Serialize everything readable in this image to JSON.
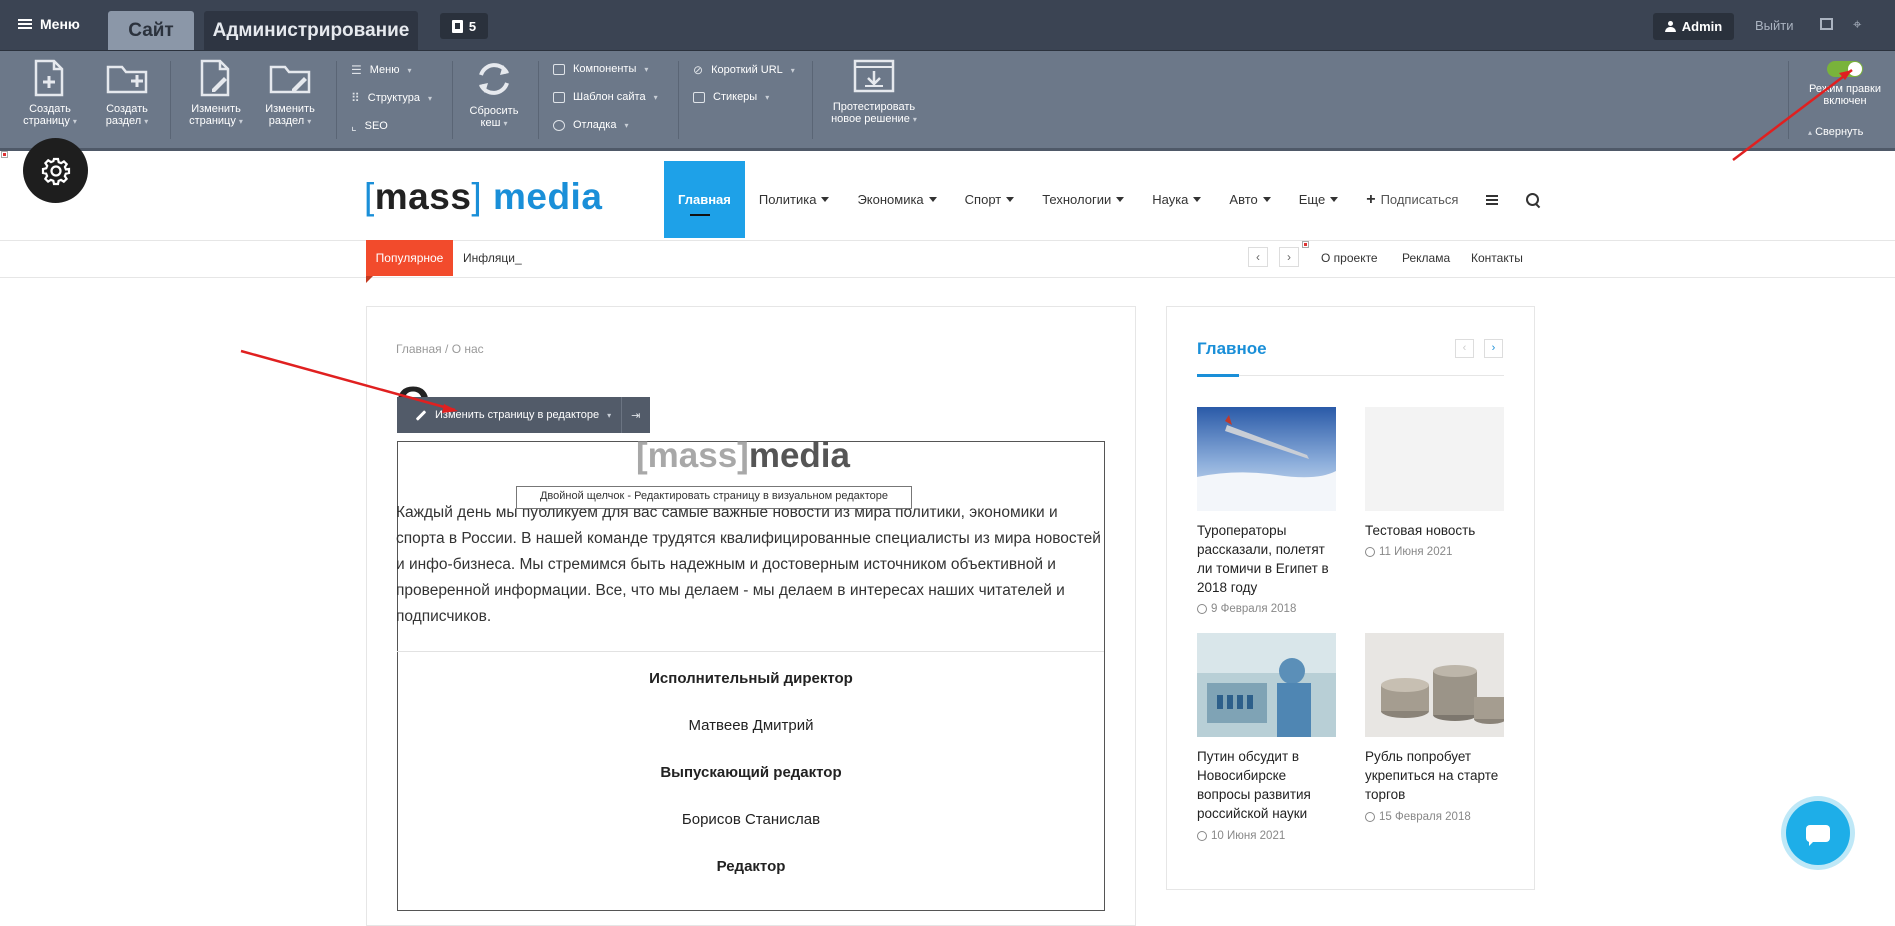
{
  "admin_bar": {
    "menu_label": "Меню",
    "tab_site": "Сайт",
    "tab_admin": "Администрирование",
    "notif_count": "5",
    "user": "Admin",
    "logout": "Выйти"
  },
  "toolbar": {
    "create_page": [
      "Создать",
      "страницу"
    ],
    "create_section": [
      "Создать",
      "раздел"
    ],
    "edit_page": [
      "Изменить",
      "страницу"
    ],
    "edit_section": [
      "Изменить",
      "раздел"
    ],
    "menu": "Меню",
    "structure": "Структура",
    "seo": "SEO",
    "clear_cache": [
      "Сбросить",
      "кеш"
    ],
    "components": "Компоненты",
    "site_template": "Шаблон сайта",
    "debug": "Отладка",
    "short_url": "Короткий URL",
    "stickers": "Стикеры",
    "test_solution": [
      "Протестировать",
      "новое решение"
    ],
    "edit_mode": [
      "Режим правки",
      "включен"
    ],
    "collapse": "Свернуть"
  },
  "site": {
    "logo_left": "[",
    "logo_mass": "mass",
    "logo_right": "]",
    "logo_media": "media",
    "nav": [
      "Главная",
      "Политика",
      "Экономика",
      "Спорт",
      "Технологии",
      "Наука",
      "Авто",
      "Еще"
    ],
    "subscribe": "Подписаться",
    "popular": "Популярное",
    "ticker": "Инфляци_",
    "top_links": [
      "О проекте",
      "Реклама",
      "Контакты"
    ]
  },
  "content": {
    "breadcrumb_home": "Главная",
    "breadcrumb_sep": " / ",
    "breadcrumb_current": "О нас",
    "heading_partial": "О",
    "edit_button": "Изменить страницу в редакторе",
    "tooltip": "Двойной щелчок - Редактировать страницу в визуальном редакторе",
    "inner_logo_mass": "[mass]",
    "inner_logo_media": "media",
    "about_text": "Каждый день мы публикуем для вас самые важные новости из мира политики, экономики и спорта в России. В нашей команде трудятся квалифицированные специалисты из мира новостей и инфо-бизнеса. Мы стремимся быть надежным и достоверным источником объективной и проверенной информации. Все, что мы делаем - мы делаем в интересах наших читателей и подписчиков.",
    "staff": [
      {
        "role": "Исполнительный директор",
        "name": "Матвеев Дмитрий"
      },
      {
        "role": "Выпускающий редактор",
        "name": "Борисов Станислав"
      },
      {
        "role": "Редактор",
        "name": ""
      }
    ]
  },
  "sidebar": {
    "title": "Главное",
    "news": [
      {
        "title": "Туроператоры рассказали, полетят ли томичи в Египет в 2018 году",
        "date": "9 Февраля 2018"
      },
      {
        "title": "Тестовая новость",
        "date": "11 Июня 2021"
      },
      {
        "title": "Путин обсудит в Новосибирске вопросы развития российской науки",
        "date": "10 Июня 2021"
      },
      {
        "title": "Рубль попробует укрепиться на старте торгов",
        "date": "15 Февраля 2018"
      }
    ]
  },
  "colors": {
    "accent": "#1a8fd8",
    "popular": "#f24b2c",
    "admin_bar": "#3b4453",
    "toolbar": "#6c7889",
    "toggle_on": "#79b33b"
  }
}
